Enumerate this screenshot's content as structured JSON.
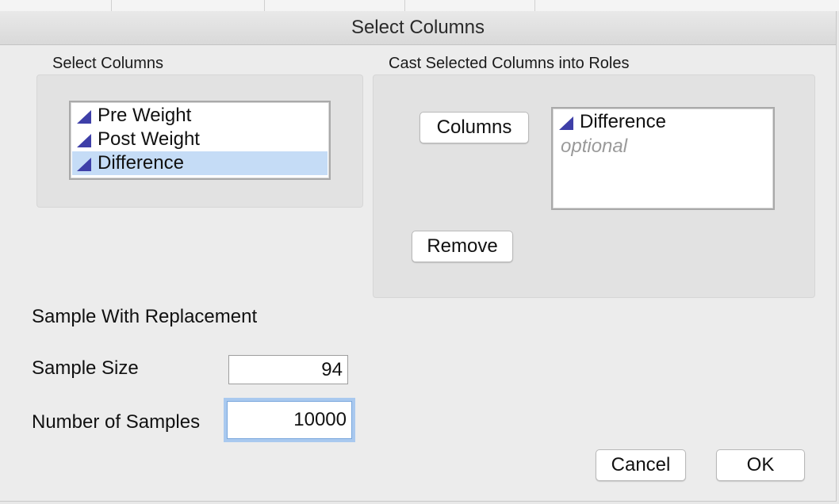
{
  "window": {
    "title": "Select Columns"
  },
  "select_columns": {
    "label": "Select Columns",
    "items": [
      {
        "label": "Pre Weight",
        "icon": "continuous-column-icon",
        "selected": false
      },
      {
        "label": "Post Weight",
        "icon": "continuous-column-icon",
        "selected": false
      },
      {
        "label": "Difference",
        "icon": "continuous-column-icon",
        "selected": true
      }
    ]
  },
  "cast_roles": {
    "label": "Cast Selected Columns into Roles",
    "columns_button": "Columns",
    "remove_button": "Remove",
    "role_list": {
      "items": [
        {
          "label": "Difference",
          "icon": "continuous-column-icon"
        }
      ],
      "placeholder": "optional"
    }
  },
  "options": {
    "heading": "Sample With Replacement",
    "sample_size": {
      "label": "Sample Size",
      "value": "94"
    },
    "num_samples": {
      "label": "Number of Samples",
      "value": "10000"
    }
  },
  "footer": {
    "cancel": "Cancel",
    "ok": "OK"
  },
  "colors": {
    "selection": "#c5dcf6",
    "icon": "#3e3fa8",
    "focus_ring": "#a9c9ef"
  }
}
